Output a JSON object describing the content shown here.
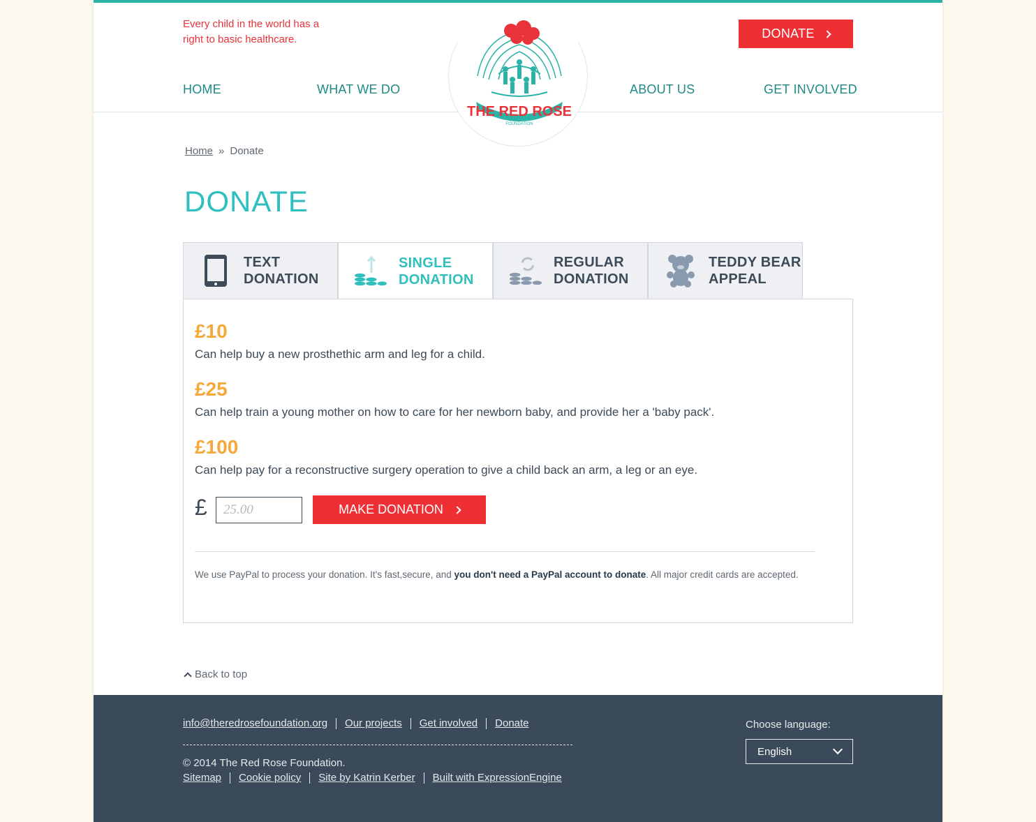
{
  "header": {
    "tagline": "Every child in the world has a right to basic healthcare.",
    "donate_button": "DONATE",
    "nav": {
      "home": "HOME",
      "what_we_do": "WHAT WE DO",
      "about_us": "ABOUT US",
      "get_involved": "GET INVOLVED"
    },
    "logo_text": "THE RED ROSE",
    "logo_subtext": "FOUNDATION"
  },
  "breadcrumb": {
    "home": "Home",
    "separator": "»",
    "current": "Donate"
  },
  "page_title": "DONATE",
  "tabs": [
    {
      "line1": "TEXT",
      "line2": "DONATION",
      "icon": "phone-icon"
    },
    {
      "line1": "SINGLE",
      "line2": "DONATION",
      "icon": "coins-up-icon"
    },
    {
      "line1": "REGULAR",
      "line2": "DONATION",
      "icon": "coins-refresh-icon"
    },
    {
      "line1": "TEDDY BEAR",
      "line2": "APPEAL",
      "icon": "teddy-bear-icon"
    }
  ],
  "amounts": [
    {
      "value": "£10",
      "desc": "Can help buy a new prosthethic arm and leg for a child."
    },
    {
      "value": "£25",
      "desc": "Can help train a young mother on how to care for her newborn baby, and provide her a 'baby pack'."
    },
    {
      "value": "£100",
      "desc": "Can help pay for a reconstructive surgery operation to give a child back an arm, a leg or an eye."
    }
  ],
  "form": {
    "currency": "£",
    "placeholder": "25.00",
    "submit": "MAKE DONATION"
  },
  "paypal": {
    "before": "We use PayPal to process your donation. It's fast,secure, and ",
    "bold": "you don't need a PayPal account to donate",
    "after": ". All major credit cards are accepted."
  },
  "back_to_top": "Back to top",
  "footer": {
    "links": [
      "info@theredrosefoundation.org",
      "Our projects",
      "Get involved",
      "Donate"
    ],
    "copyright": "© 2014 The Red Rose Foundation.",
    "legal_links": [
      "Sitemap",
      "Cookie policy",
      "Site by Katrin Kerber",
      "Built with ExpressionEngine"
    ],
    "language_label": "Choose language:",
    "language_value": "English"
  },
  "colors": {
    "teal": "#2fbfbe",
    "red": "#ee2f33",
    "orange": "#f5a93a",
    "footer": "#3b4a5a"
  }
}
